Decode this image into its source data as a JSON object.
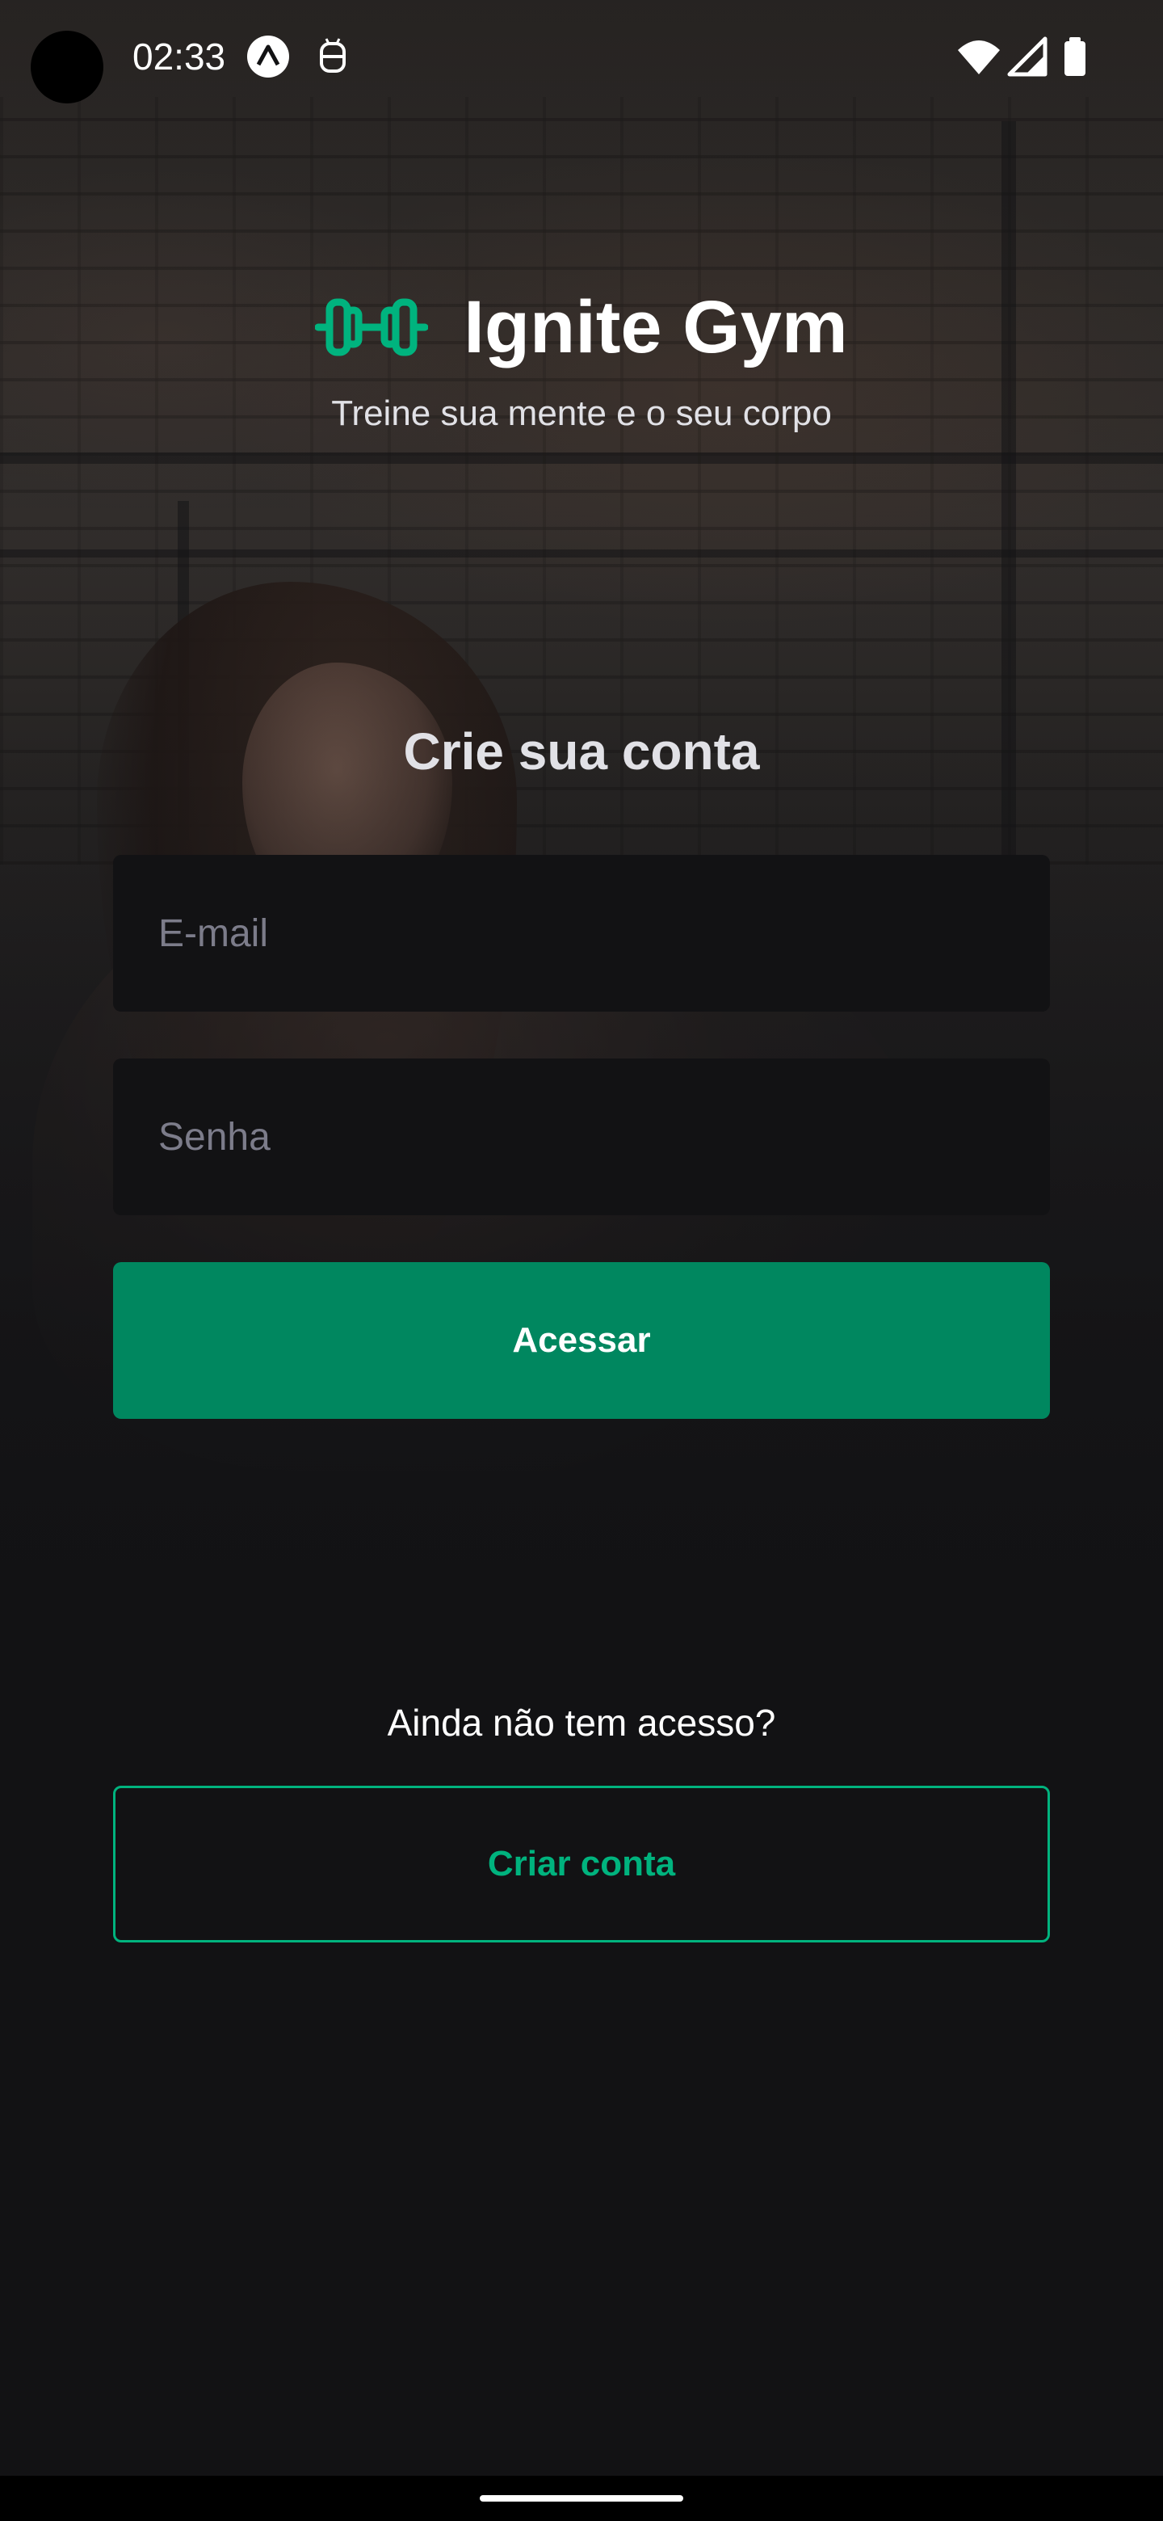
{
  "status_bar": {
    "time": "02:33",
    "icons": [
      "expo-app-icon",
      "android-debug-icon",
      "wifi-icon",
      "signal-icon",
      "battery-icon"
    ]
  },
  "header": {
    "app_name": "Ignite Gym",
    "tagline": "Treine sua mente e o seu corpo",
    "logo_icon": "dumbbell-icon"
  },
  "form": {
    "title": "Crie sua conta",
    "email_placeholder": "E-mail",
    "email_value": "",
    "password_placeholder": "Senha",
    "password_value": "",
    "submit_label": "Acessar"
  },
  "footer": {
    "no_access_text": "Ainda não tem acesso?",
    "create_account_label": "Criar conta"
  },
  "colors": {
    "background": "#121214",
    "input_background": "#121214",
    "primary_button": "#00875f",
    "accent": "#00b37e",
    "title_text": "#e1e1e6",
    "placeholder_text": "#7c7c8a"
  }
}
